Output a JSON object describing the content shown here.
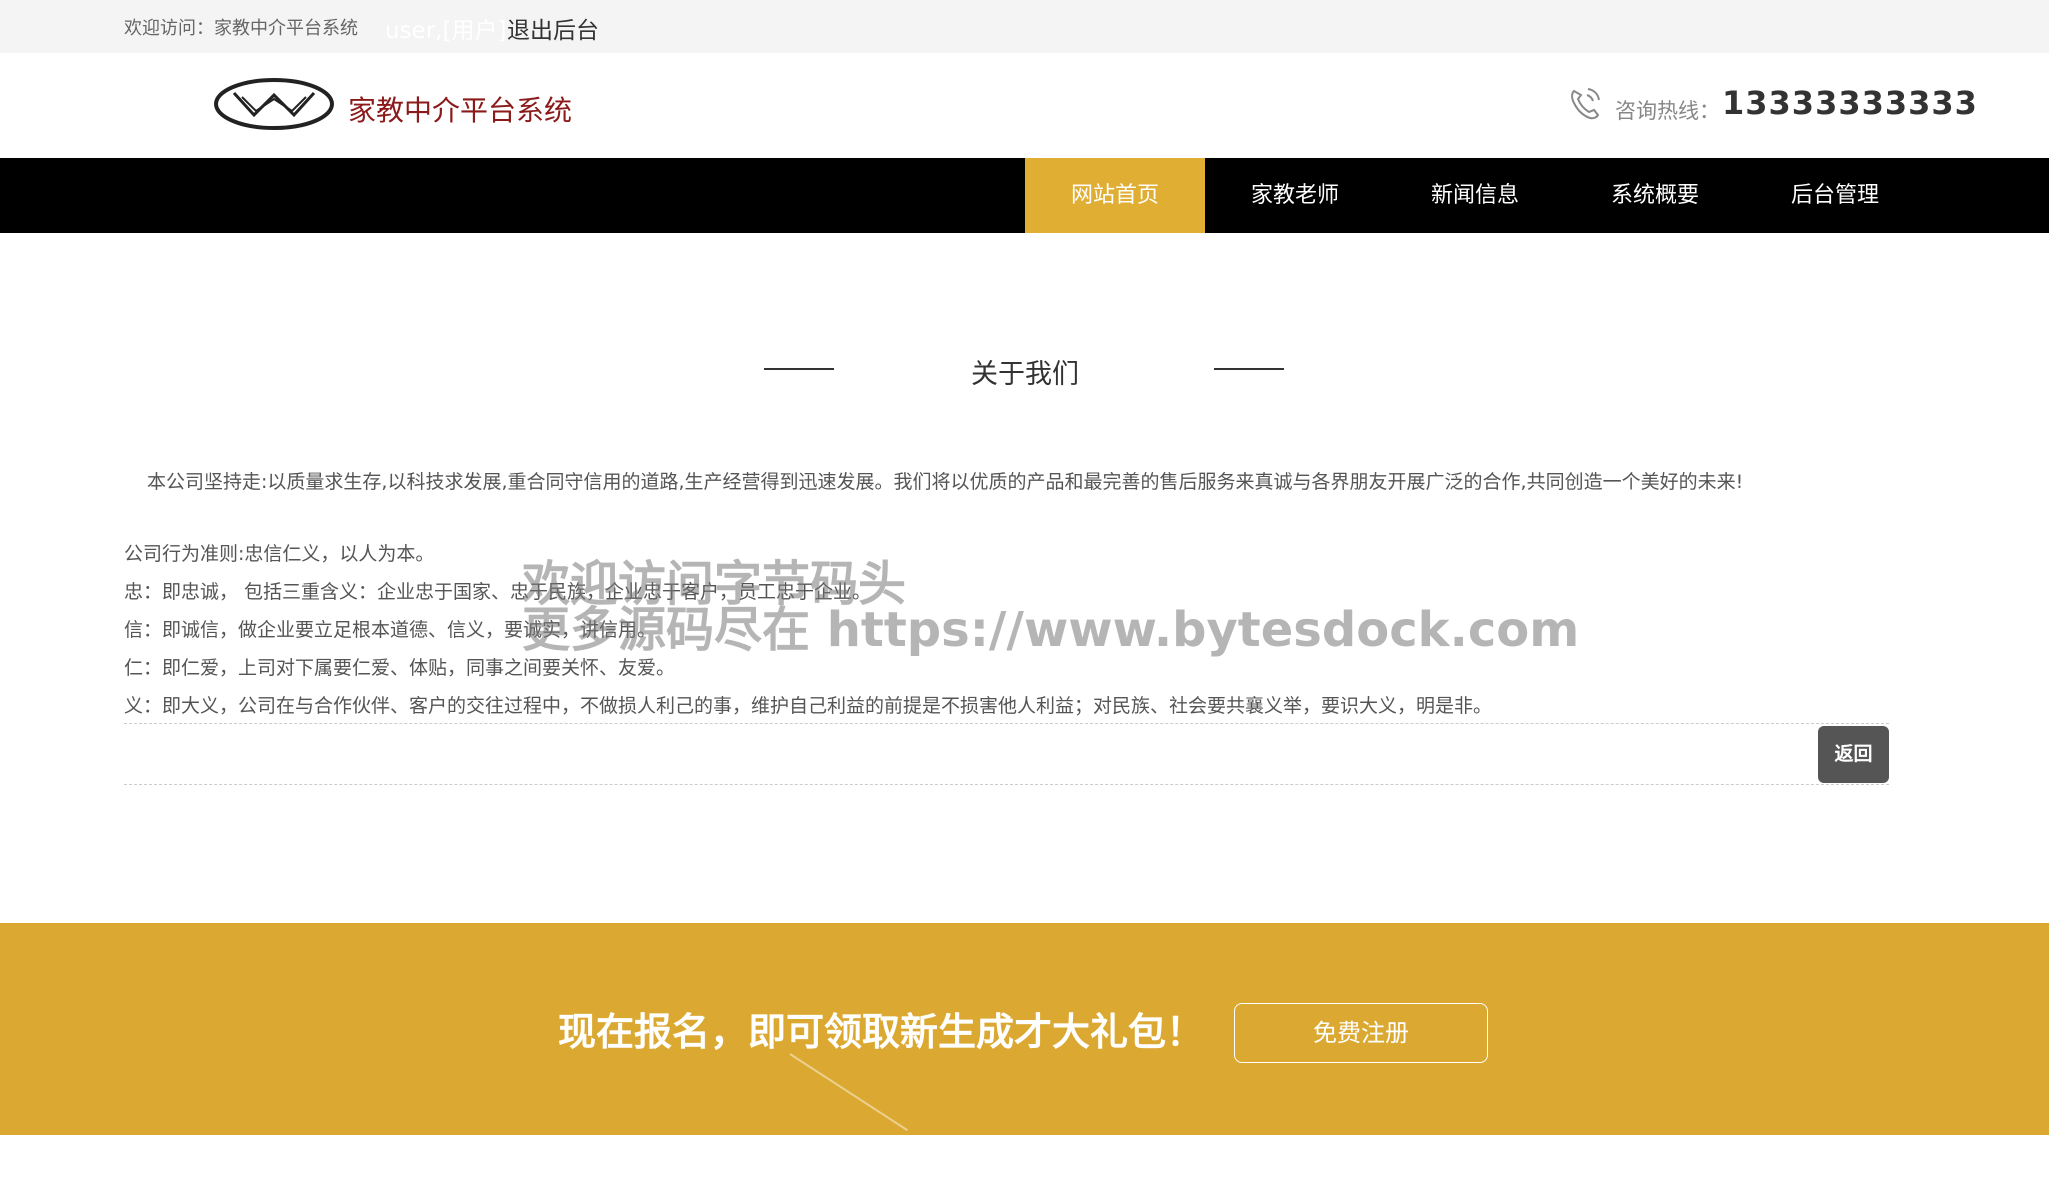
{
  "topbar": {
    "welcome": "欢迎访问：家教中介平台系统",
    "user": "user,[用户]",
    "logout": "退出后台"
  },
  "header": {
    "site_name": "家教中介平台系统",
    "hotline_label": "咨询热线：",
    "hotline_number": "13333333333",
    "logo_icon": "logo-ellipse-w",
    "hotline_icon": "phone-icon"
  },
  "nav": {
    "items": [
      {
        "label": "网站首页",
        "active": true
      },
      {
        "label": "家教老师",
        "active": false
      },
      {
        "label": "新闻信息",
        "active": false
      },
      {
        "label": "系统概要",
        "active": false
      },
      {
        "label": "后台管理",
        "active": false
      }
    ],
    "active_color": "#dfae32"
  },
  "about": {
    "title": "关于我们",
    "intro": "本公司坚持走:以质量求生存,以科技求发展,重合同守信用的道路,生产经营得到迅速发展。我们将以优质的产品和最完善的售后服务来真诚与各界朋友开展广泛的合作,共同创造一个美好的未来!",
    "principles": [
      "公司行为准则:忠信仁义，以人为本。",
      "忠：即忠诚， 包括三重含义：企业忠于国家、忠于民族，企业忠于客户，员工忠于企业。",
      "信：即诚信，做企业要立足根本道德、信义，要诚实，讲信用。",
      "仁：即仁爱，上司对下属要仁爱、体贴，同事之间要关怀、友爱。",
      "义：即大义，公司在与合作伙伴、客户的交往过程中，不做损人利己的事，维护自己利益的前提是不损害他人利益；对民族、社会要共襄义举，要识大义，明是非。"
    ],
    "back_label": "返回"
  },
  "watermark": {
    "line1": "欢迎访问字节码头",
    "line2": "更多源码尽在  https://www.bytesdock.com"
  },
  "banner": {
    "text": "现在报名，即可领取新生成才大礼包！",
    "register_label": "免费注册",
    "color": "#dba932"
  }
}
